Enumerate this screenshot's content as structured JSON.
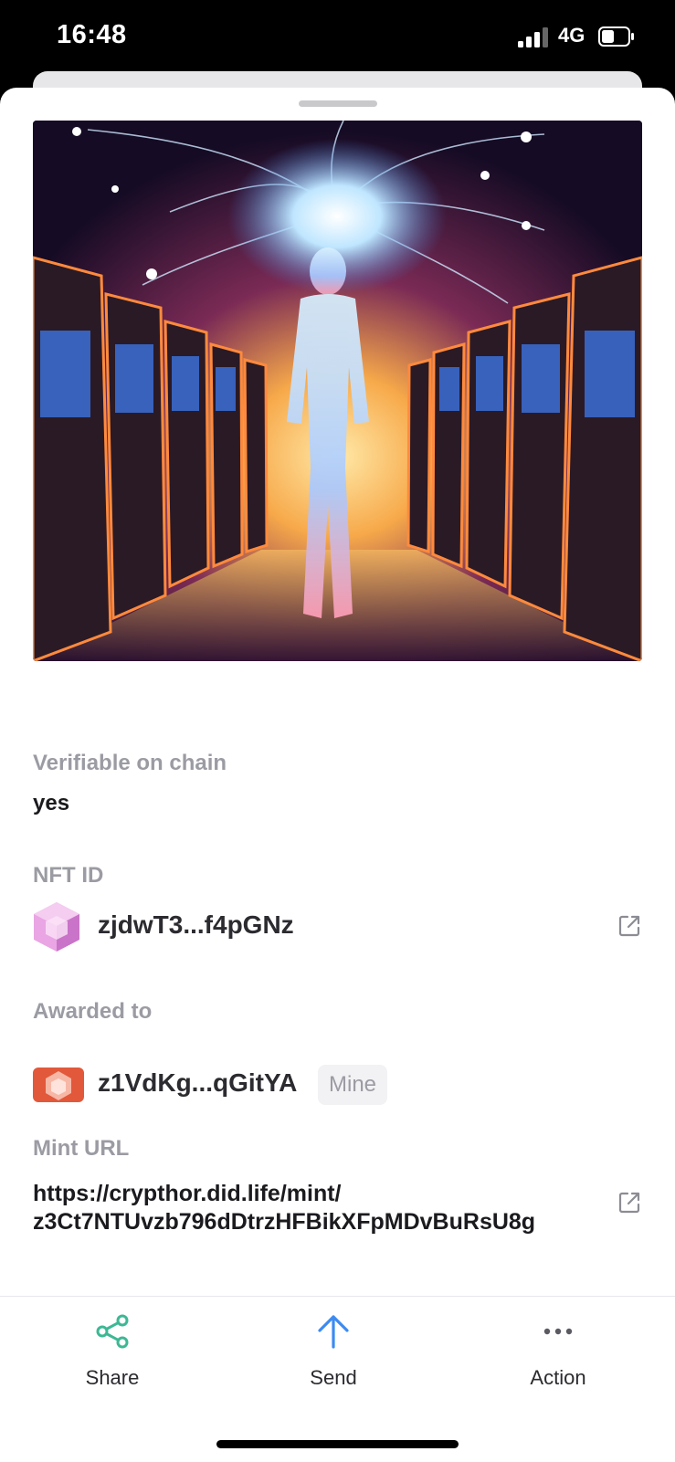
{
  "status_bar": {
    "time": "16:48",
    "network": "4G"
  },
  "fields": {
    "verifiable_label": "Verifiable on chain",
    "verifiable_value": "yes",
    "nft_id_label": "NFT ID",
    "nft_id_value": "zjdwT3...f4pGNz",
    "awarded_label": "Awarded to",
    "awarded_value": "z1VdKg...qGitYA",
    "mine_badge": "Mine",
    "mint_url_label": "Mint URL",
    "mint_url_line1": "https://crypthor.did.life/mint/",
    "mint_url_line2": "z3Ct7NTUvzb796dDtrzHFBikXFpMDvBuRsU8g"
  },
  "tabbar": {
    "share_label": "Share",
    "send_label": "Send",
    "action_label": "Action"
  },
  "icons": {
    "share": "share-icon",
    "send": "arrow-up-icon",
    "action": "more-dots-icon",
    "external": "external-link-icon"
  },
  "colors": {
    "share_icon": "#3db894",
    "send_icon": "#3d8bf0",
    "label": "#9b9ba3",
    "value": "#1b1b1f"
  }
}
